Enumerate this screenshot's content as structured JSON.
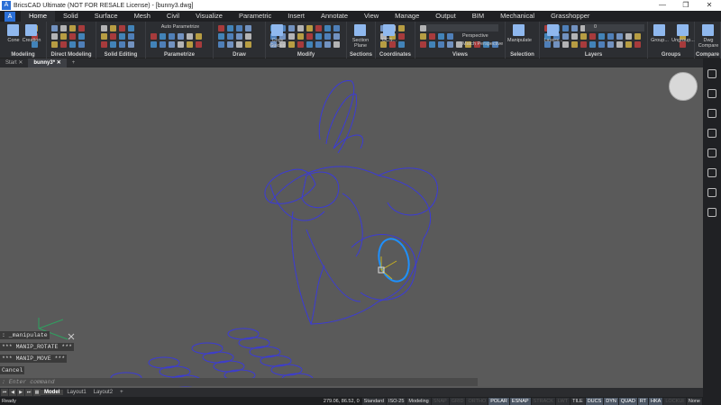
{
  "titlebar": {
    "title": "BricsCAD Ultimate (NOT FOR RESALE License) - [bunny3.dwg]",
    "minimize": "—",
    "maximize": "❐",
    "close": "✕"
  },
  "menu": {
    "tabs": [
      "Home",
      "Solid",
      "Surface",
      "Mesh",
      "Civil",
      "Visualize",
      "Parametric",
      "Insert",
      "Annotate",
      "View",
      "Manage",
      "Output",
      "BIM",
      "Mechanical",
      "Grasshopper"
    ]
  },
  "ribbon": {
    "panels": [
      "Modeling",
      "Direct Modeling",
      "Solid Editing",
      "Parametrize",
      "Draw",
      "Modify",
      "Sections",
      "Coordinates",
      "Views",
      "Selection",
      "Layers",
      "Groups",
      "Compare"
    ],
    "buttons": {
      "cone": "Cone",
      "creation": "Creation",
      "auto_parametrize": "Auto Parametrize",
      "copy_guided": "Copy Guided",
      "section_plane": "Section Plane",
      "ucs": "UCS...",
      "perspective": "Perspective",
      "match_perspective": "Match Perspective",
      "manipulate": "Manipulate",
      "layers": "Layers...",
      "layer_value": "0",
      "group": "Group...",
      "ungroup": "Ungroup...",
      "dwg_compare": "Dwg Compare"
    }
  },
  "doctabs": [
    {
      "label": "Start"
    },
    {
      "label": "bunny3*"
    }
  ],
  "command": {
    "history": [
      ": _manipulate",
      "*** MANIP_ROTATE ***",
      "*** MANIP_MOVE ***",
      "Cancel"
    ],
    "placeholder": ": Enter command"
  },
  "layouts": [
    "Model",
    "Layout1",
    "Layout2",
    "+"
  ],
  "status": {
    "ready": "Ready",
    "coords": "279.06, 86.52, 0",
    "toggles": [
      {
        "t": "Standard",
        "s": "n"
      },
      {
        "t": "ISO-25",
        "s": "n"
      },
      {
        "t": "Modeling",
        "s": "n"
      },
      {
        "t": "SNAP",
        "s": "off"
      },
      {
        "t": "GRID",
        "s": "off"
      },
      {
        "t": "ORTHO",
        "s": "off"
      },
      {
        "t": "POLAR",
        "s": "on"
      },
      {
        "t": "ESNAP",
        "s": "on"
      },
      {
        "t": "STRACK",
        "s": "off"
      },
      {
        "t": "LWT",
        "s": "off"
      },
      {
        "t": "TILE",
        "s": "n"
      },
      {
        "t": "DUCS",
        "s": "on"
      },
      {
        "t": "DYN",
        "s": "on"
      },
      {
        "t": "QUAD",
        "s": "on"
      },
      {
        "t": "RT",
        "s": "on"
      },
      {
        "t": "HKA",
        "s": "on"
      },
      {
        "t": "LOCKUI",
        "s": "off"
      },
      {
        "t": "None",
        "s": "n"
      }
    ]
  },
  "colors": {
    "accent": "#2a6fd6",
    "drawing": "#3b3bd6",
    "highlight": "#1e90ff"
  }
}
